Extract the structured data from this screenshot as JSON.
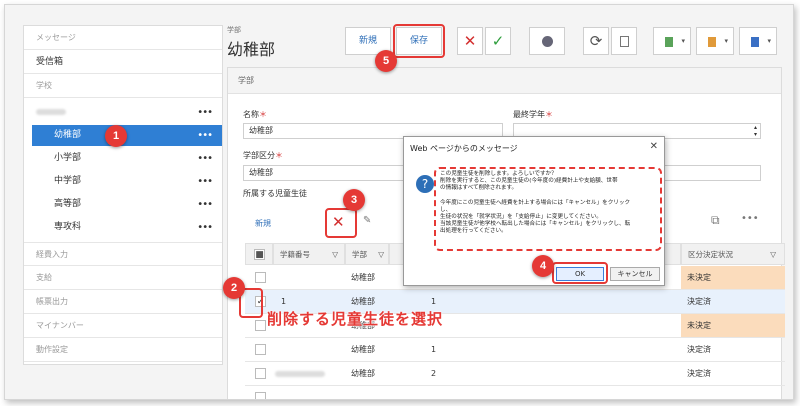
{
  "sidebar": {
    "header": "メッセージ",
    "inbox": "受信箱",
    "school": "学校",
    "dots": "•••",
    "items": [
      "幼稚部",
      "小学部",
      "中学部",
      "高等部",
      "専攻科"
    ],
    "sections": [
      "経費入力",
      "支給",
      "帳票出力",
      "マイナンバー",
      "動作設定"
    ]
  },
  "header": {
    "breadcrumb": "学部",
    "title": "幼稚部",
    "new_label": "新規",
    "save_label": "保存"
  },
  "panel": {
    "heading": "学部",
    "name_label": "名称",
    "name_value": "幼稚部",
    "final_grade_label": "最終学年",
    "division_label": "学部区分",
    "division_value": "幼稚部",
    "students_label": "所属する児童生徒",
    "new_link": "新規",
    "columns": [
      "学籍番号",
      "学部",
      "区分決定状況"
    ],
    "rows": [
      {
        "id": "",
        "dept": "幼稚部",
        "status": "未決定",
        "orange": true,
        "checked": false
      },
      {
        "id": "1",
        "dept": "幼稚部",
        "num": "1",
        "status": "決定済",
        "orange": false,
        "checked": true
      },
      {
        "id": "",
        "dept": "幼稚部",
        "status": "未決定",
        "orange": true,
        "checked": false
      },
      {
        "id": "",
        "dept": "幼稚部",
        "num": "1",
        "status": "決定済",
        "orange": false,
        "checked": false
      },
      {
        "id": "",
        "dept": "幼稚部",
        "num": "2",
        "status": "決定済",
        "orange": false,
        "checked": false
      },
      {
        "id": "",
        "dept": "",
        "status": "",
        "orange": false,
        "checked": false
      }
    ]
  },
  "dialog": {
    "title": "Web ページからのメッセージ",
    "close": "✕",
    "message_lines": [
      "この児童生徒を削除します。よろしいですか？",
      "削除を実行すると、この児童生徒の(今年度の)経費計上や支給額、世帯",
      "の情報はすべて削除されます。",
      "",
      "今年度にこの児童生徒へ経費を計上する場合には「キャンセル」をクリック",
      "し、",
      "生徒の状況を「就学状況」を「支給停止」に変更してください。",
      "当該児童生徒が他学校へ転出した場合には「キャンセル」をクリックし、転",
      "出処理を行ってください。"
    ],
    "ok_label": "OK",
    "cancel_label": "キャンセル"
  },
  "annotations": {
    "callout": "削除する児童生徒を選択",
    "badges": [
      "1",
      "2",
      "3",
      "4",
      "5"
    ]
  },
  "colors": {
    "accent": "#2f7fd4",
    "annotation": "#e53935",
    "undecided": "#fbdcbc"
  }
}
